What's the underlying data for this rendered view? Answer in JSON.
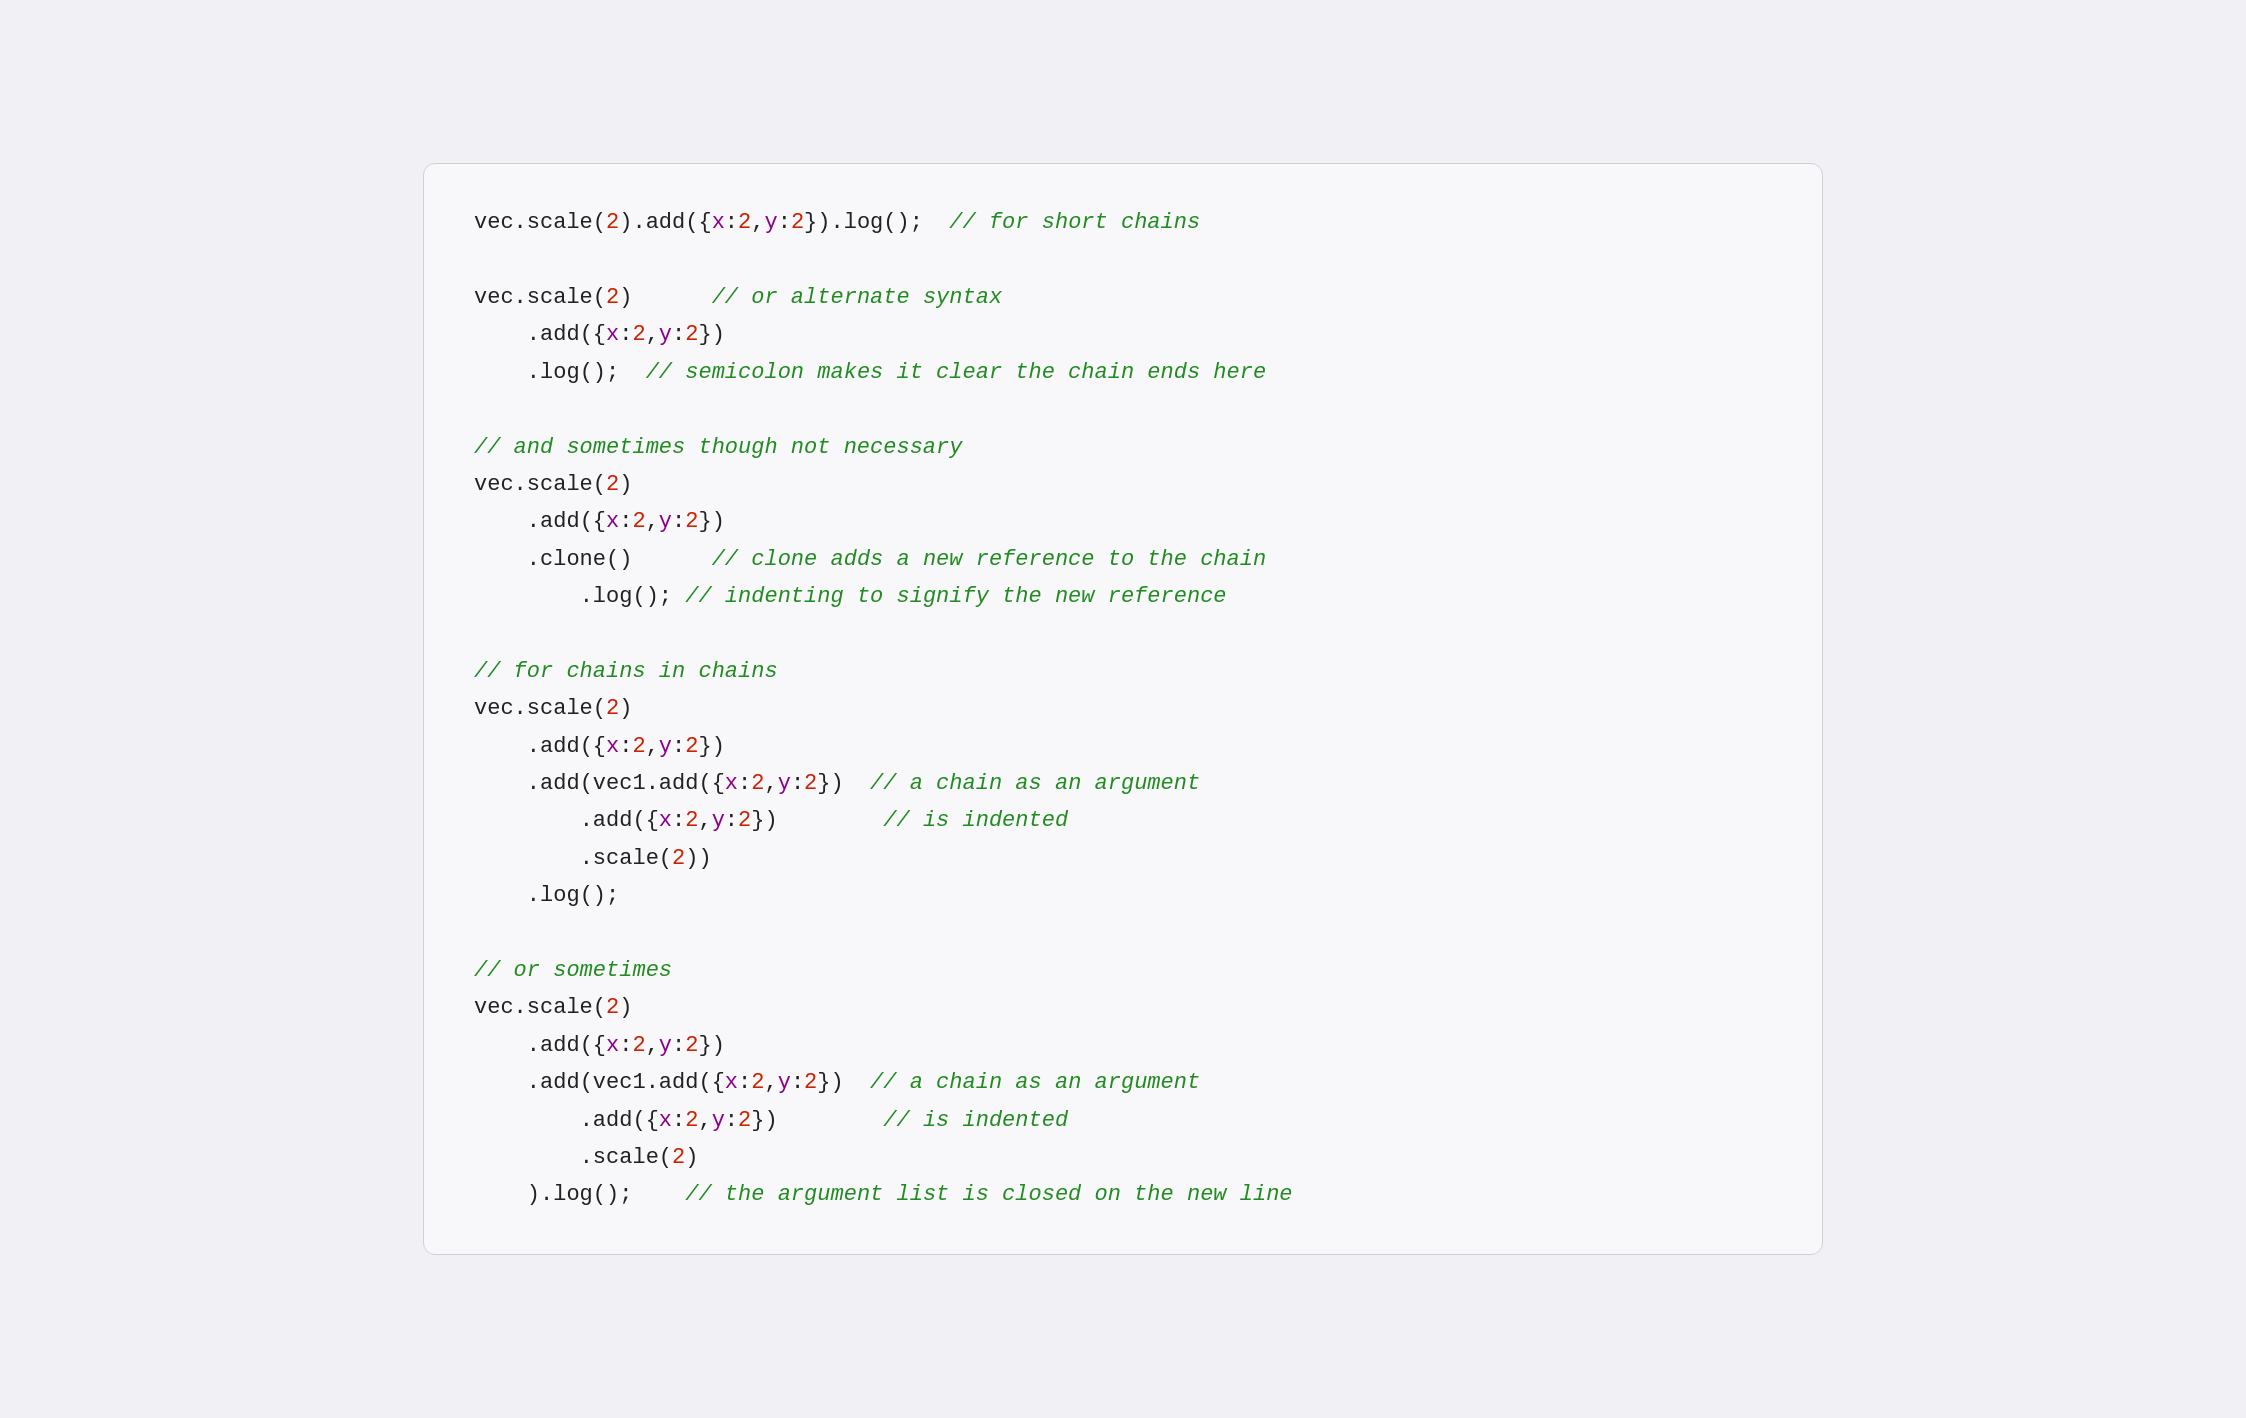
{
  "code": {
    "lines": [
      {
        "id": "line1",
        "parts": [
          {
            "text": "vec",
            "color": "black"
          },
          {
            "text": ".",
            "color": "black"
          },
          {
            "text": "scale",
            "color": "black"
          },
          {
            "text": "(",
            "color": "black"
          },
          {
            "text": "2",
            "color": "red"
          },
          {
            "text": ")",
            "color": "black"
          },
          {
            "text": ".",
            "color": "black"
          },
          {
            "text": "add",
            "color": "black"
          },
          {
            "text": "({",
            "color": "black"
          },
          {
            "text": "x",
            "color": "purple"
          },
          {
            "text": ":",
            "color": "black"
          },
          {
            "text": "2",
            "color": "red"
          },
          {
            "text": ",",
            "color": "black"
          },
          {
            "text": "y",
            "color": "purple"
          },
          {
            "text": ":",
            "color": "black"
          },
          {
            "text": "2",
            "color": "red"
          },
          {
            "text": "})",
            "color": "black"
          },
          {
            "text": ".",
            "color": "black"
          },
          {
            "text": "log",
            "color": "black"
          },
          {
            "text": "();  ",
            "color": "black"
          },
          {
            "text": "// for short chains",
            "color": "green"
          }
        ]
      },
      {
        "id": "blank1",
        "blank": true
      },
      {
        "id": "line2",
        "parts": [
          {
            "text": "vec",
            "color": "black"
          },
          {
            "text": ".",
            "color": "black"
          },
          {
            "text": "scale",
            "color": "black"
          },
          {
            "text": "(",
            "color": "black"
          },
          {
            "text": "2",
            "color": "red"
          },
          {
            "text": ")      ",
            "color": "black"
          },
          {
            "text": "// or alternate syntax",
            "color": "green"
          }
        ]
      },
      {
        "id": "line3",
        "indent": "    ",
        "parts": [
          {
            "text": ".",
            "color": "black"
          },
          {
            "text": "add",
            "color": "black"
          },
          {
            "text": "({",
            "color": "black"
          },
          {
            "text": "x",
            "color": "purple"
          },
          {
            "text": ":",
            "color": "black"
          },
          {
            "text": "2",
            "color": "red"
          },
          {
            "text": ",",
            "color": "black"
          },
          {
            "text": "y",
            "color": "purple"
          },
          {
            "text": ":",
            "color": "black"
          },
          {
            "text": "2",
            "color": "red"
          },
          {
            "text": "})",
            "color": "black"
          }
        ]
      },
      {
        "id": "line4",
        "indent": "    ",
        "parts": [
          {
            "text": ".",
            "color": "black"
          },
          {
            "text": "log",
            "color": "black"
          },
          {
            "text": "();  ",
            "color": "black"
          },
          {
            "text": "// semicolon makes it clear the chain ends here",
            "color": "green"
          }
        ]
      },
      {
        "id": "blank2",
        "blank": true
      },
      {
        "id": "line5",
        "parts": [
          {
            "text": "// and sometimes though not necessary",
            "color": "green"
          }
        ]
      },
      {
        "id": "line6",
        "parts": [
          {
            "text": "vec",
            "color": "black"
          },
          {
            "text": ".",
            "color": "black"
          },
          {
            "text": "scale",
            "color": "black"
          },
          {
            "text": "(",
            "color": "black"
          },
          {
            "text": "2",
            "color": "red"
          },
          {
            "text": ")",
            "color": "black"
          }
        ]
      },
      {
        "id": "line7",
        "indent": "    ",
        "parts": [
          {
            "text": ".",
            "color": "black"
          },
          {
            "text": "add",
            "color": "black"
          },
          {
            "text": "({",
            "color": "black"
          },
          {
            "text": "x",
            "color": "purple"
          },
          {
            "text": ":",
            "color": "black"
          },
          {
            "text": "2",
            "color": "red"
          },
          {
            "text": ",",
            "color": "black"
          },
          {
            "text": "y",
            "color": "purple"
          },
          {
            "text": ":",
            "color": "black"
          },
          {
            "text": "2",
            "color": "red"
          },
          {
            "text": "})",
            "color": "black"
          }
        ]
      },
      {
        "id": "line8",
        "indent": "    ",
        "parts": [
          {
            "text": ".",
            "color": "black"
          },
          {
            "text": "clone",
            "color": "black"
          },
          {
            "text": "()      ",
            "color": "black"
          },
          {
            "text": "// clone adds a new reference to the chain",
            "color": "green"
          }
        ]
      },
      {
        "id": "line9",
        "indent": "        ",
        "parts": [
          {
            "text": ".",
            "color": "black"
          },
          {
            "text": "log",
            "color": "black"
          },
          {
            "text": "(); ",
            "color": "black"
          },
          {
            "text": "// indenting to signify the new reference",
            "color": "green"
          }
        ]
      },
      {
        "id": "blank3",
        "blank": true
      },
      {
        "id": "line10",
        "parts": [
          {
            "text": "// for chains in chains",
            "color": "green"
          }
        ]
      },
      {
        "id": "line11",
        "parts": [
          {
            "text": "vec",
            "color": "black"
          },
          {
            "text": ".",
            "color": "black"
          },
          {
            "text": "scale",
            "color": "black"
          },
          {
            "text": "(",
            "color": "black"
          },
          {
            "text": "2",
            "color": "red"
          },
          {
            "text": ")",
            "color": "black"
          }
        ]
      },
      {
        "id": "line12",
        "indent": "    ",
        "parts": [
          {
            "text": ".",
            "color": "black"
          },
          {
            "text": "add",
            "color": "black"
          },
          {
            "text": "({",
            "color": "black"
          },
          {
            "text": "x",
            "color": "purple"
          },
          {
            "text": ":",
            "color": "black"
          },
          {
            "text": "2",
            "color": "red"
          },
          {
            "text": ",",
            "color": "black"
          },
          {
            "text": "y",
            "color": "purple"
          },
          {
            "text": ":",
            "color": "black"
          },
          {
            "text": "2",
            "color": "red"
          },
          {
            "text": "})",
            "color": "black"
          }
        ]
      },
      {
        "id": "line13",
        "indent": "    ",
        "parts": [
          {
            "text": ".",
            "color": "black"
          },
          {
            "text": "add",
            "color": "black"
          },
          {
            "text": "(vec1.",
            "color": "black"
          },
          {
            "text": "add",
            "color": "black"
          },
          {
            "text": "({",
            "color": "black"
          },
          {
            "text": "x",
            "color": "purple"
          },
          {
            "text": ":",
            "color": "black"
          },
          {
            "text": "2",
            "color": "red"
          },
          {
            "text": ",",
            "color": "black"
          },
          {
            "text": "y",
            "color": "purple"
          },
          {
            "text": ":",
            "color": "black"
          },
          {
            "text": "2",
            "color": "red"
          },
          {
            "text": "})  ",
            "color": "black"
          },
          {
            "text": "// a chain as an argument",
            "color": "green"
          }
        ]
      },
      {
        "id": "line14",
        "indent": "        ",
        "parts": [
          {
            "text": ".",
            "color": "black"
          },
          {
            "text": "add",
            "color": "black"
          },
          {
            "text": "({",
            "color": "black"
          },
          {
            "text": "x",
            "color": "purple"
          },
          {
            "text": ":",
            "color": "black"
          },
          {
            "text": "2",
            "color": "red"
          },
          {
            "text": ",",
            "color": "black"
          },
          {
            "text": "y",
            "color": "purple"
          },
          {
            "text": ":",
            "color": "black"
          },
          {
            "text": "2",
            "color": "red"
          },
          {
            "text": "})        ",
            "color": "black"
          },
          {
            "text": "// is indented",
            "color": "green"
          }
        ]
      },
      {
        "id": "line15",
        "indent": "        ",
        "parts": [
          {
            "text": ".",
            "color": "black"
          },
          {
            "text": "scale",
            "color": "black"
          },
          {
            "text": "(",
            "color": "black"
          },
          {
            "text": "2",
            "color": "red"
          },
          {
            "text": "))",
            "color": "black"
          }
        ]
      },
      {
        "id": "line16",
        "indent": "    ",
        "parts": [
          {
            "text": ".",
            "color": "black"
          },
          {
            "text": "log",
            "color": "black"
          },
          {
            "text": "();",
            "color": "black"
          }
        ]
      },
      {
        "id": "blank4",
        "blank": true
      },
      {
        "id": "line17",
        "parts": [
          {
            "text": "// or sometimes",
            "color": "green"
          }
        ]
      },
      {
        "id": "line18",
        "parts": [
          {
            "text": "vec",
            "color": "black"
          },
          {
            "text": ".",
            "color": "black"
          },
          {
            "text": "scale",
            "color": "black"
          },
          {
            "text": "(",
            "color": "black"
          },
          {
            "text": "2",
            "color": "red"
          },
          {
            "text": ")",
            "color": "black"
          }
        ]
      },
      {
        "id": "line19",
        "indent": "    ",
        "parts": [
          {
            "text": ".",
            "color": "black"
          },
          {
            "text": "add",
            "color": "black"
          },
          {
            "text": "({",
            "color": "black"
          },
          {
            "text": "x",
            "color": "purple"
          },
          {
            "text": ":",
            "color": "black"
          },
          {
            "text": "2",
            "color": "red"
          },
          {
            "text": ",",
            "color": "black"
          },
          {
            "text": "y",
            "color": "purple"
          },
          {
            "text": ":",
            "color": "black"
          },
          {
            "text": "2",
            "color": "red"
          },
          {
            "text": "})",
            "color": "black"
          }
        ]
      },
      {
        "id": "line20",
        "indent": "    ",
        "parts": [
          {
            "text": ".",
            "color": "black"
          },
          {
            "text": "add",
            "color": "black"
          },
          {
            "text": "(vec1.",
            "color": "black"
          },
          {
            "text": "add",
            "color": "black"
          },
          {
            "text": "({",
            "color": "black"
          },
          {
            "text": "x",
            "color": "purple"
          },
          {
            "text": ":",
            "color": "black"
          },
          {
            "text": "2",
            "color": "red"
          },
          {
            "text": ",",
            "color": "black"
          },
          {
            "text": "y",
            "color": "purple"
          },
          {
            "text": ":",
            "color": "black"
          },
          {
            "text": "2",
            "color": "red"
          },
          {
            "text": "})  ",
            "color": "black"
          },
          {
            "text": "// a chain as an argument",
            "color": "green"
          }
        ]
      },
      {
        "id": "line21",
        "indent": "        ",
        "parts": [
          {
            "text": ".",
            "color": "black"
          },
          {
            "text": "add",
            "color": "black"
          },
          {
            "text": "({",
            "color": "black"
          },
          {
            "text": "x",
            "color": "purple"
          },
          {
            "text": ":",
            "color": "black"
          },
          {
            "text": "2",
            "color": "red"
          },
          {
            "text": ",",
            "color": "black"
          },
          {
            "text": "y",
            "color": "purple"
          },
          {
            "text": ":",
            "color": "black"
          },
          {
            "text": "2",
            "color": "red"
          },
          {
            "text": "})        ",
            "color": "black"
          },
          {
            "text": "// is indented",
            "color": "green"
          }
        ]
      },
      {
        "id": "line22",
        "indent": "        ",
        "parts": [
          {
            "text": ".",
            "color": "black"
          },
          {
            "text": "scale",
            "color": "black"
          },
          {
            "text": "(",
            "color": "black"
          },
          {
            "text": "2",
            "color": "red"
          },
          {
            "text": ")",
            "color": "black"
          }
        ]
      },
      {
        "id": "line23",
        "indent": "    ",
        "parts": [
          {
            "text": ").log();    ",
            "color": "black"
          },
          {
            "text": "// the argument list is closed on the new line",
            "color": "green"
          }
        ]
      }
    ]
  }
}
